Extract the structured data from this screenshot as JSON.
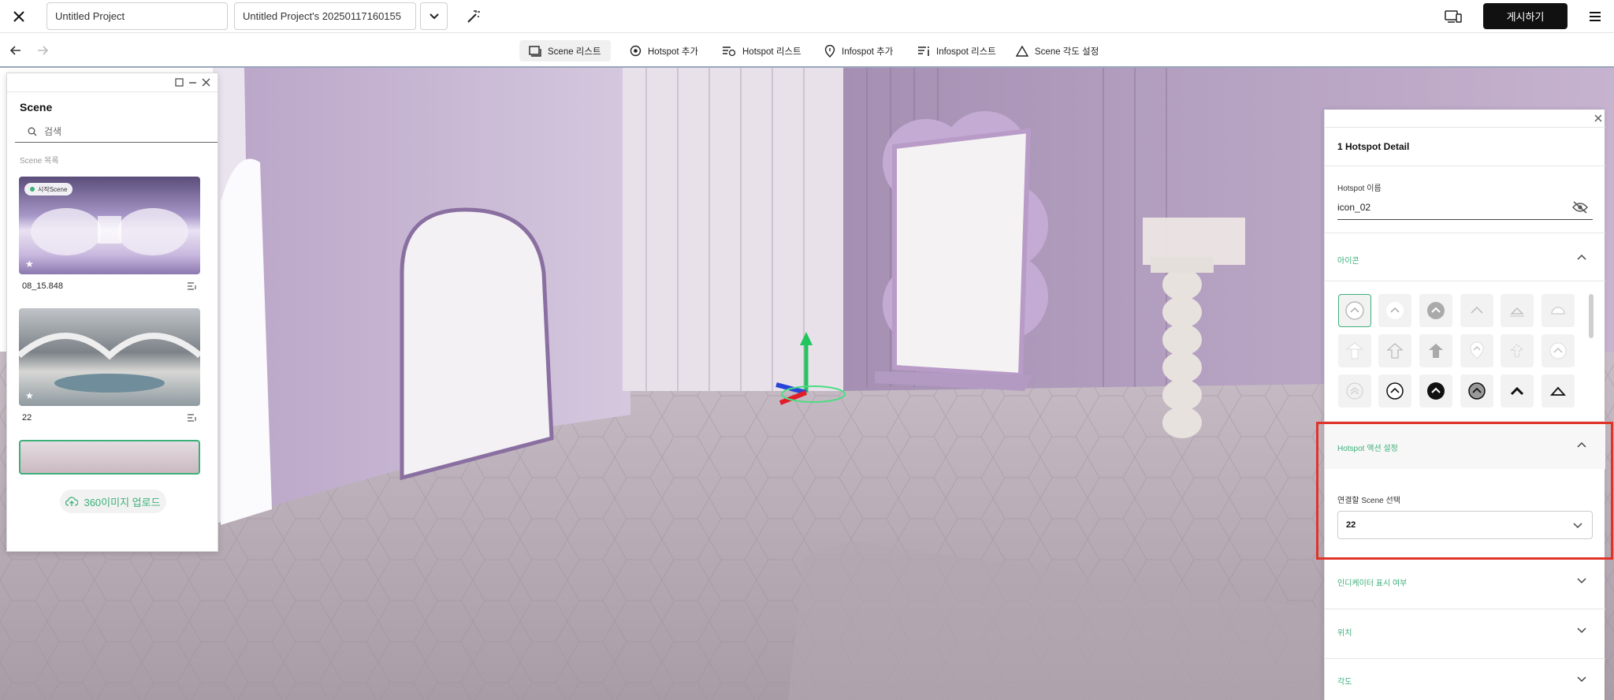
{
  "header": {
    "project_name": "Untitled Project",
    "project_version": "Untitled Project's 20250117160155",
    "publish_label": "게시하기"
  },
  "toolbar": {
    "items": [
      {
        "label": "Scene 리스트",
        "icon": "scene-list-icon",
        "active": true
      },
      {
        "label": "Hotspot 추가",
        "icon": "hotspot-add-icon"
      },
      {
        "label": "Hotspot 리스트",
        "icon": "hotspot-list-icon"
      },
      {
        "label": "Infospot 추가",
        "icon": "infospot-add-icon"
      },
      {
        "label": "Infospot 리스트",
        "icon": "infospot-list-icon"
      },
      {
        "label": "Scene 각도 설정",
        "icon": "scene-angle-icon"
      }
    ]
  },
  "scene_panel": {
    "title": "Scene",
    "search_placeholder": "검색",
    "list_label": "Scene 목록",
    "start_badge": "시작Scene",
    "scenes": [
      {
        "label": "08_15.848"
      },
      {
        "label": "22"
      },
      {
        "label": ""
      }
    ],
    "upload_label": "360이미지 업로드"
  },
  "hotspot_detail": {
    "title": "1 Hotspot Detail",
    "name_label": "Hotspot 이름",
    "name_value": "icon_02",
    "icon_section": "아이콘",
    "action_section": "Hotspot 액션 설정",
    "link_scene_label": "연결할 Scene 선택",
    "link_scene_value": "22",
    "indicator_section": "인디케이터 표시 여부",
    "position_section": "위치",
    "angle_section": "각도"
  },
  "colors": {
    "accent": "#3db07a",
    "highlight": "#e0332a",
    "dark": "#111111"
  }
}
